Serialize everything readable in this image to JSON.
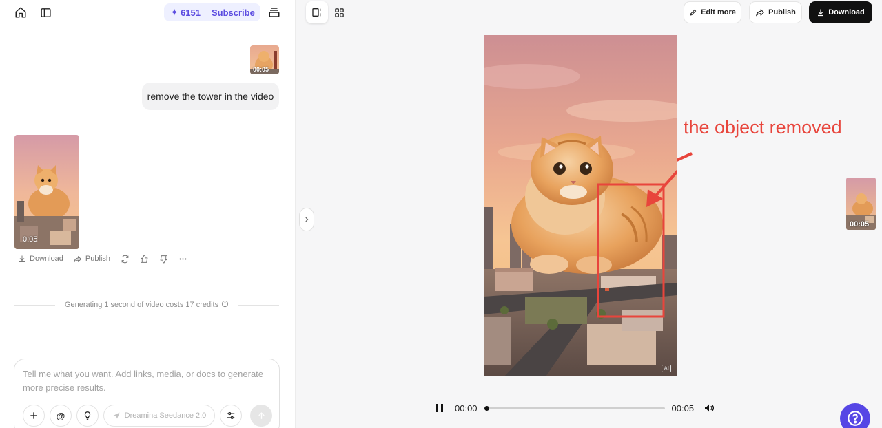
{
  "header": {
    "credits": "6151",
    "subscribe_label": "Subscribe"
  },
  "chat": {
    "input_thumb_duration": "00:05",
    "user_message": "remove the tower in the video",
    "result_duration": "0:05",
    "actions": {
      "download": "Download",
      "publish": "Publish"
    },
    "cost_note": "Generating 1 second of video costs 17 credits"
  },
  "composer": {
    "placeholder": "Tell me what you want. Add links, media, or docs to generate more precise results.",
    "model_label": "Dreamina Seedance 2.0"
  },
  "toolbar": {
    "edit_more": "Edit more",
    "publish": "Publish",
    "download": "Download"
  },
  "preview": {
    "ai_badge": "AI",
    "annotation": "the object removed",
    "side_thumb_duration": "00:05"
  },
  "player": {
    "current_time": "00:00",
    "total_time": "00:05",
    "progress": 0.0
  },
  "colors": {
    "accent": "#5646e5",
    "annotation": "#e8453c",
    "credits_bg": "#eef0ff"
  }
}
